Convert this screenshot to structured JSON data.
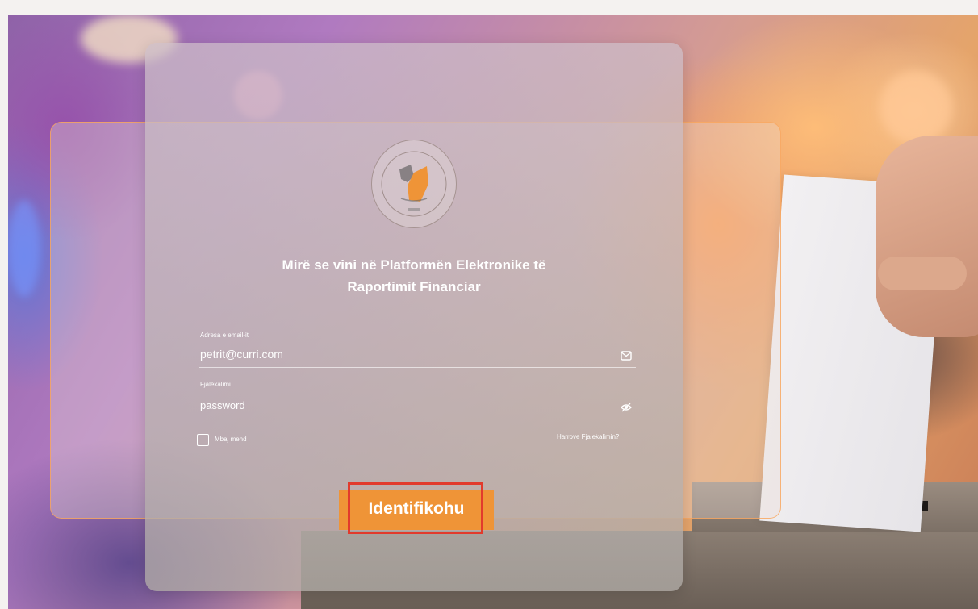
{
  "login": {
    "title_line1": "Mirë se vini në Platformën Elektronike të",
    "title_line2": "Raportimit Financiar",
    "email_label": "Adresa e email-it",
    "email_value": "petrit@curri.com",
    "password_label": "Fjalekalimi",
    "password_value": "password",
    "remember_label": "Mbaj mend",
    "forgot_label": "Harrove Fjalekalimin?",
    "submit_label": "Identifikohu"
  },
  "colors": {
    "accent": "#ef9437",
    "highlight": "#e23a2c"
  },
  "icons": {
    "email": "mail-icon",
    "password": "eye-off-icon"
  }
}
